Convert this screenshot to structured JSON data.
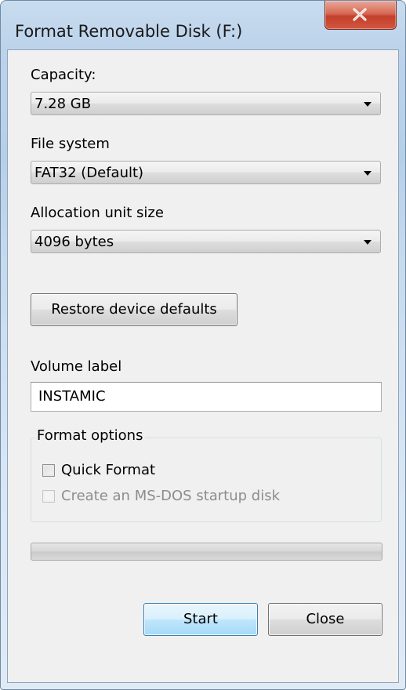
{
  "window": {
    "title": "Format Removable Disk (F:)",
    "close_icon": "close-x-icon"
  },
  "capacity": {
    "label": "Capacity:",
    "value": "7.28 GB"
  },
  "file_system": {
    "label": "File system",
    "value": "FAT32 (Default)"
  },
  "allocation_unit": {
    "label": "Allocation unit size",
    "value": "4096 bytes"
  },
  "restore_defaults_label": "Restore device defaults",
  "volume_label": {
    "label": "Volume label",
    "value": "INSTAMIC"
  },
  "format_options": {
    "legend": "Format options",
    "quick_format": {
      "label": "Quick Format",
      "checked": false,
      "enabled": true
    },
    "msdos_startup": {
      "label": "Create an MS-DOS startup disk",
      "checked": false,
      "enabled": false
    }
  },
  "progress": {
    "fraction": 0
  },
  "buttons": {
    "start_label": "Start",
    "close_label": "Close"
  },
  "colors": {
    "close_button_red": "#c3402b",
    "default_button_blue": "#3c7fb1",
    "window_frame": "#b9d1ea"
  }
}
